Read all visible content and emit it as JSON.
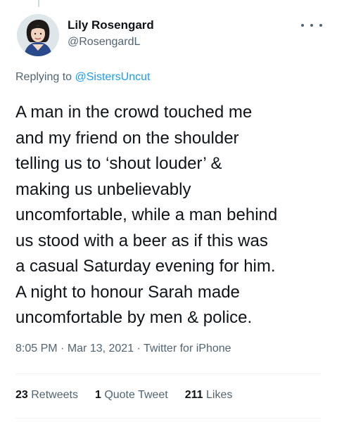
{
  "author": {
    "name": "Lily Rosengard",
    "handle": "@RosengardL"
  },
  "more_icon": "more-horizontal-icon",
  "replying": {
    "prefix": "Replying to ",
    "mention": "@SistersUncut"
  },
  "tweet": {
    "lines": [
      "A man in the crowd touched me",
      "and my friend on the shoulder",
      "telling us to ‘shout louder’ &",
      "making us unbelievably",
      "uncomfortable, while a man behind",
      "us stood with a beer as if this was",
      "a casual Saturday evening for him.",
      "A night to honour Sarah made",
      "uncomfortable by men & police."
    ]
  },
  "meta": {
    "time": "8:05 PM",
    "separator": " · ",
    "date": "Mar 13, 2021",
    "source": "Twitter for iPhone"
  },
  "stats": {
    "retweets": {
      "count": "23",
      "label": "Retweets"
    },
    "quotes": {
      "count": "1",
      "label": "Quote Tweet"
    },
    "likes": {
      "count": "211",
      "label": "Likes"
    }
  },
  "colors": {
    "link": "#1d9bf0",
    "secondary": "#536471",
    "primary": "#0f1419",
    "divider": "#eff3f4"
  }
}
